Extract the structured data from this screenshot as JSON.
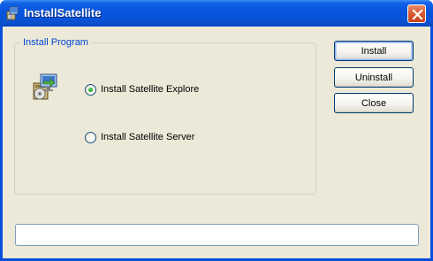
{
  "window": {
    "title": "InstallSatellite",
    "icon": "installer-icon",
    "close_icon": "close-icon"
  },
  "group": {
    "title": "Install Program",
    "icon": "setup-package-icon",
    "options": [
      {
        "label": "Install Satellite Explore",
        "selected": true
      },
      {
        "label": "Install Satellite Server",
        "selected": false
      }
    ]
  },
  "buttons": {
    "install": "Install",
    "uninstall": "Uninstall",
    "close": "Close"
  },
  "status": {
    "text": ""
  },
  "colors": {
    "titlebar": "#0a52d4",
    "client": "#ece9d8",
    "group_title": "#0046d5",
    "close_button": "#db5b32"
  }
}
